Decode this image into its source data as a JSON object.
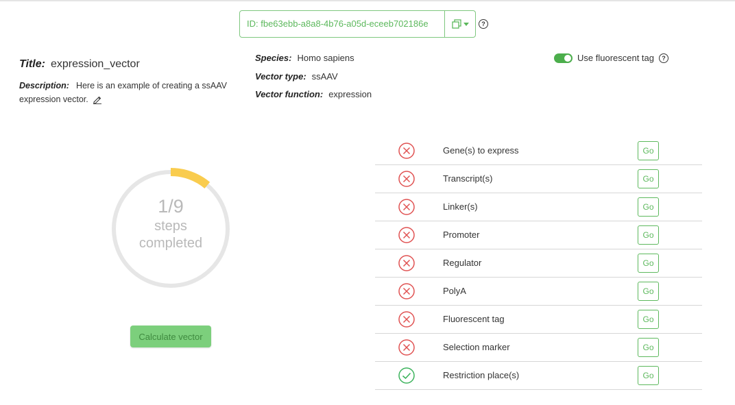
{
  "vector": {
    "id": "ID: fbe63ebb-a8a8-4b76-a05d-eceeb702186e",
    "title_label": "Title:",
    "title": "expression_vector",
    "description_label": "Description:",
    "description": "Here is an example of creating a ssAAV expression vector.",
    "species_label": "Species:",
    "species": "Homo sapiens",
    "vector_type_label": "Vector type:",
    "vector_type": "ssAAV",
    "vector_function_label": "Vector function:",
    "vector_function": "expression"
  },
  "fluorescent_toggle": {
    "label": "Use fluorescent tag",
    "enabled": true
  },
  "progress": {
    "count": "1/9",
    "line1": "steps",
    "line2": "completed",
    "fraction": 0.111,
    "color": "#f9cc4e",
    "track_color": "#e6e6e6"
  },
  "actions": {
    "calculate": "Calculate vector",
    "go": "Go"
  },
  "steps": [
    {
      "name": "Gene(s) to express",
      "done": false
    },
    {
      "name": "Transcript(s)",
      "done": false
    },
    {
      "name": "Linker(s)",
      "done": false
    },
    {
      "name": "Promoter",
      "done": false
    },
    {
      "name": "Regulator",
      "done": false
    },
    {
      "name": "PolyA",
      "done": false
    },
    {
      "name": "Fluorescent tag",
      "done": false
    },
    {
      "name": "Selection marker",
      "done": false
    },
    {
      "name": "Restriction place(s)",
      "done": true
    }
  ],
  "colors": {
    "accent": "#5cb85c",
    "error": "#e05252",
    "success": "#3cb35c"
  },
  "icons": {
    "copy": "copy-icon",
    "help": "question-circle-icon",
    "edit": "pencil-icon",
    "error": "x-circle-icon",
    "success": "check-circle-icon"
  }
}
